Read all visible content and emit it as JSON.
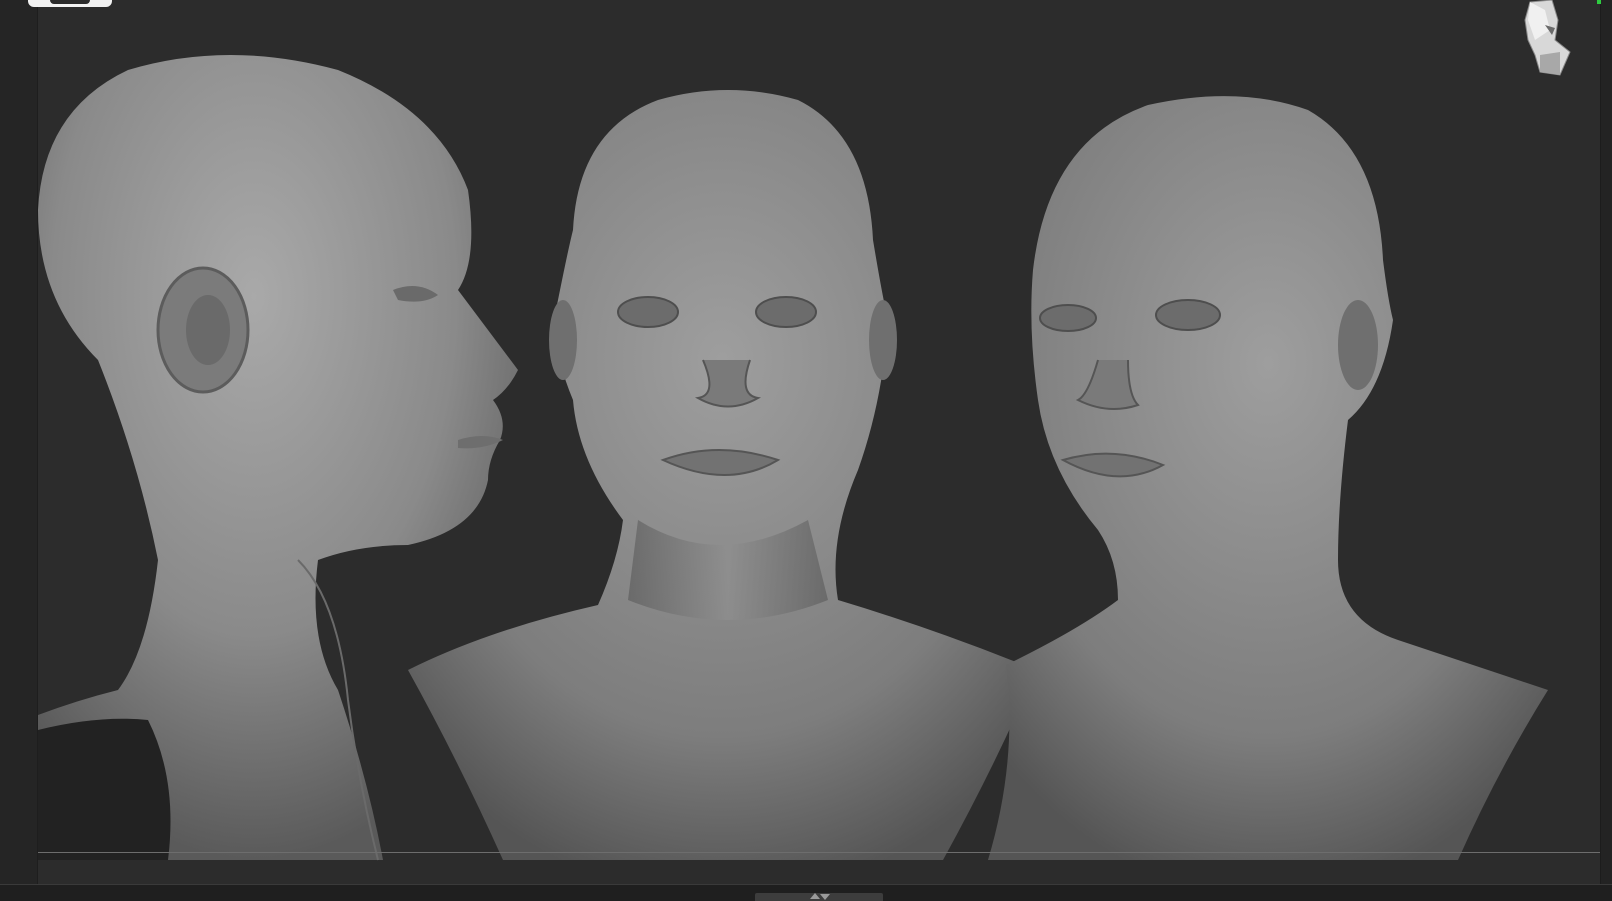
{
  "app": {
    "title": ""
  },
  "viewport": {
    "background": "#2c2c2c",
    "model_material": "#8c8c8c",
    "views": [
      {
        "view": "side-profile"
      },
      {
        "view": "front"
      },
      {
        "view": "three-quarter"
      }
    ]
  },
  "icons": {
    "navigation": "head-navigation-gizmo-icon",
    "shelf_toggle": "shelf-toggle-arrows-icon",
    "corner": "corner-toggle-icon"
  },
  "colors": {
    "accent": "#2ecc40",
    "panel": "#252525",
    "shelf": "#1f1f1f"
  }
}
